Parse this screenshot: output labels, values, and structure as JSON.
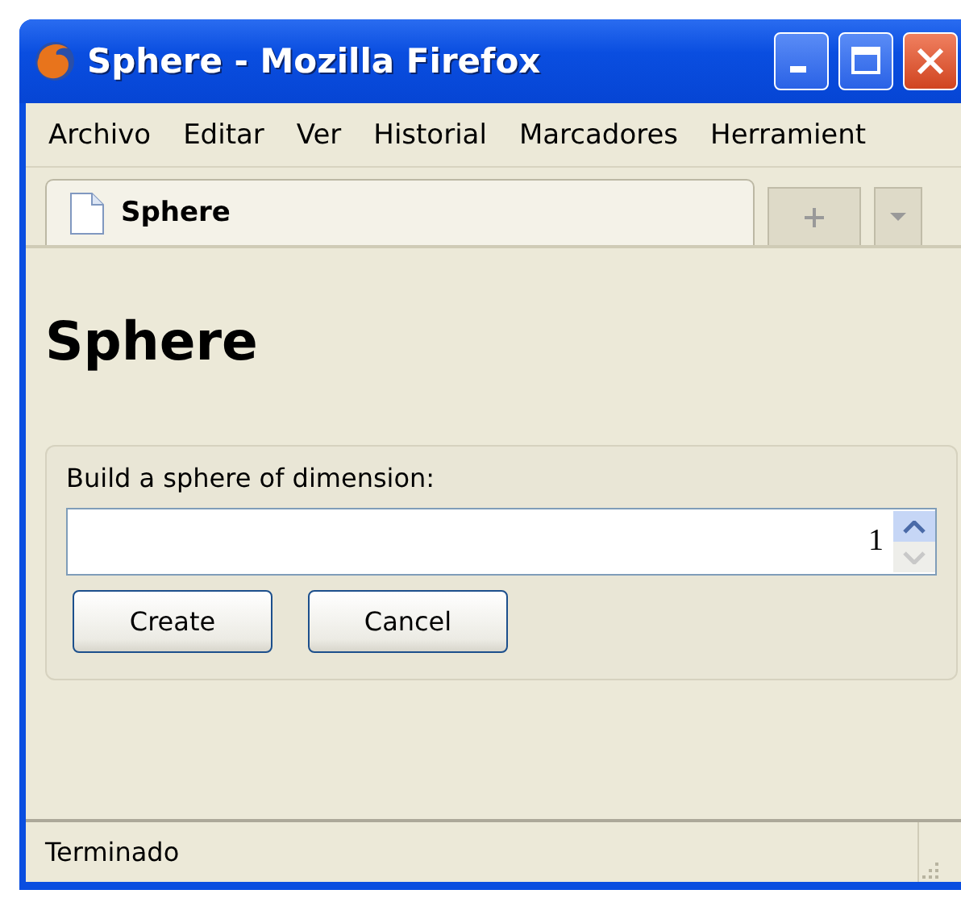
{
  "window": {
    "title": "Sphere - Mozilla Firefox"
  },
  "menu": [
    {
      "label": "Archivo"
    },
    {
      "label": "Editar"
    },
    {
      "label": "Ver"
    },
    {
      "label": "Historial"
    },
    {
      "label": "Marcadores"
    },
    {
      "label": "Herramient"
    }
  ],
  "tabs": [
    {
      "label": "Sphere",
      "selected": true
    }
  ],
  "page": {
    "heading": "Sphere",
    "label": "Build a sphere of dimension:",
    "dimension": {
      "value": "1"
    },
    "buttons": [
      {
        "label": "Create"
      },
      {
        "label": "Cancel"
      }
    ]
  },
  "status_bar": "Terminado"
}
